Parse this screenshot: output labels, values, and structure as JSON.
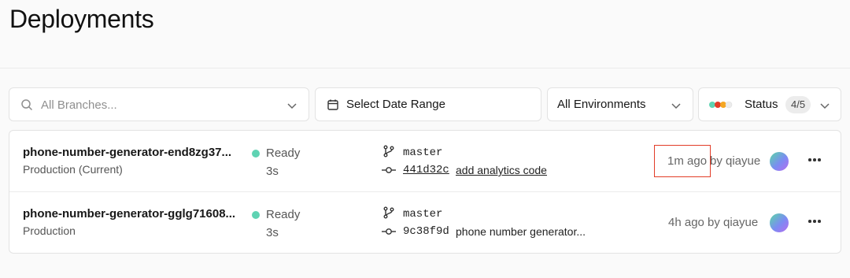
{
  "page": {
    "title": "Deployments"
  },
  "filters": {
    "branch_placeholder": "All Branches...",
    "date_label": "Select Date Range",
    "environment_label": "All Environments",
    "status_label": "Status",
    "status_count": "4/5",
    "status_colors": [
      "#5fd3b3",
      "#e23d28",
      "#f5a623",
      "#ececec"
    ]
  },
  "deployments": [
    {
      "name": "phone-number-generator-end8zg37...",
      "environment": "Production (Current)",
      "state": "Ready",
      "duration": "3s",
      "branch": "master",
      "commit_hash": "441d32c",
      "commit_message": "add analytics code",
      "time": "1m ago",
      "author": "by qiayue"
    },
    {
      "name": "phone-number-generator-gglg71608...",
      "environment": "Production",
      "state": "Ready",
      "duration": "3s",
      "branch": "master",
      "commit_hash": "9c38f9d",
      "commit_message": "phone number generator...",
      "time": "4h ago",
      "author": "by qiayue"
    }
  ],
  "colors": {
    "ready": "#5fd3b3",
    "highlight": "#e23d28",
    "avatar": [
      "#5ad8a6",
      "#7b8cf2",
      "#b66cf0"
    ]
  },
  "icons": {
    "search": "search-icon",
    "calendar": "calendar-icon",
    "chevron": "chevron-down-icon",
    "branch": "git-branch-icon",
    "commit": "git-commit-icon",
    "more": "more-horizontal-icon"
  }
}
